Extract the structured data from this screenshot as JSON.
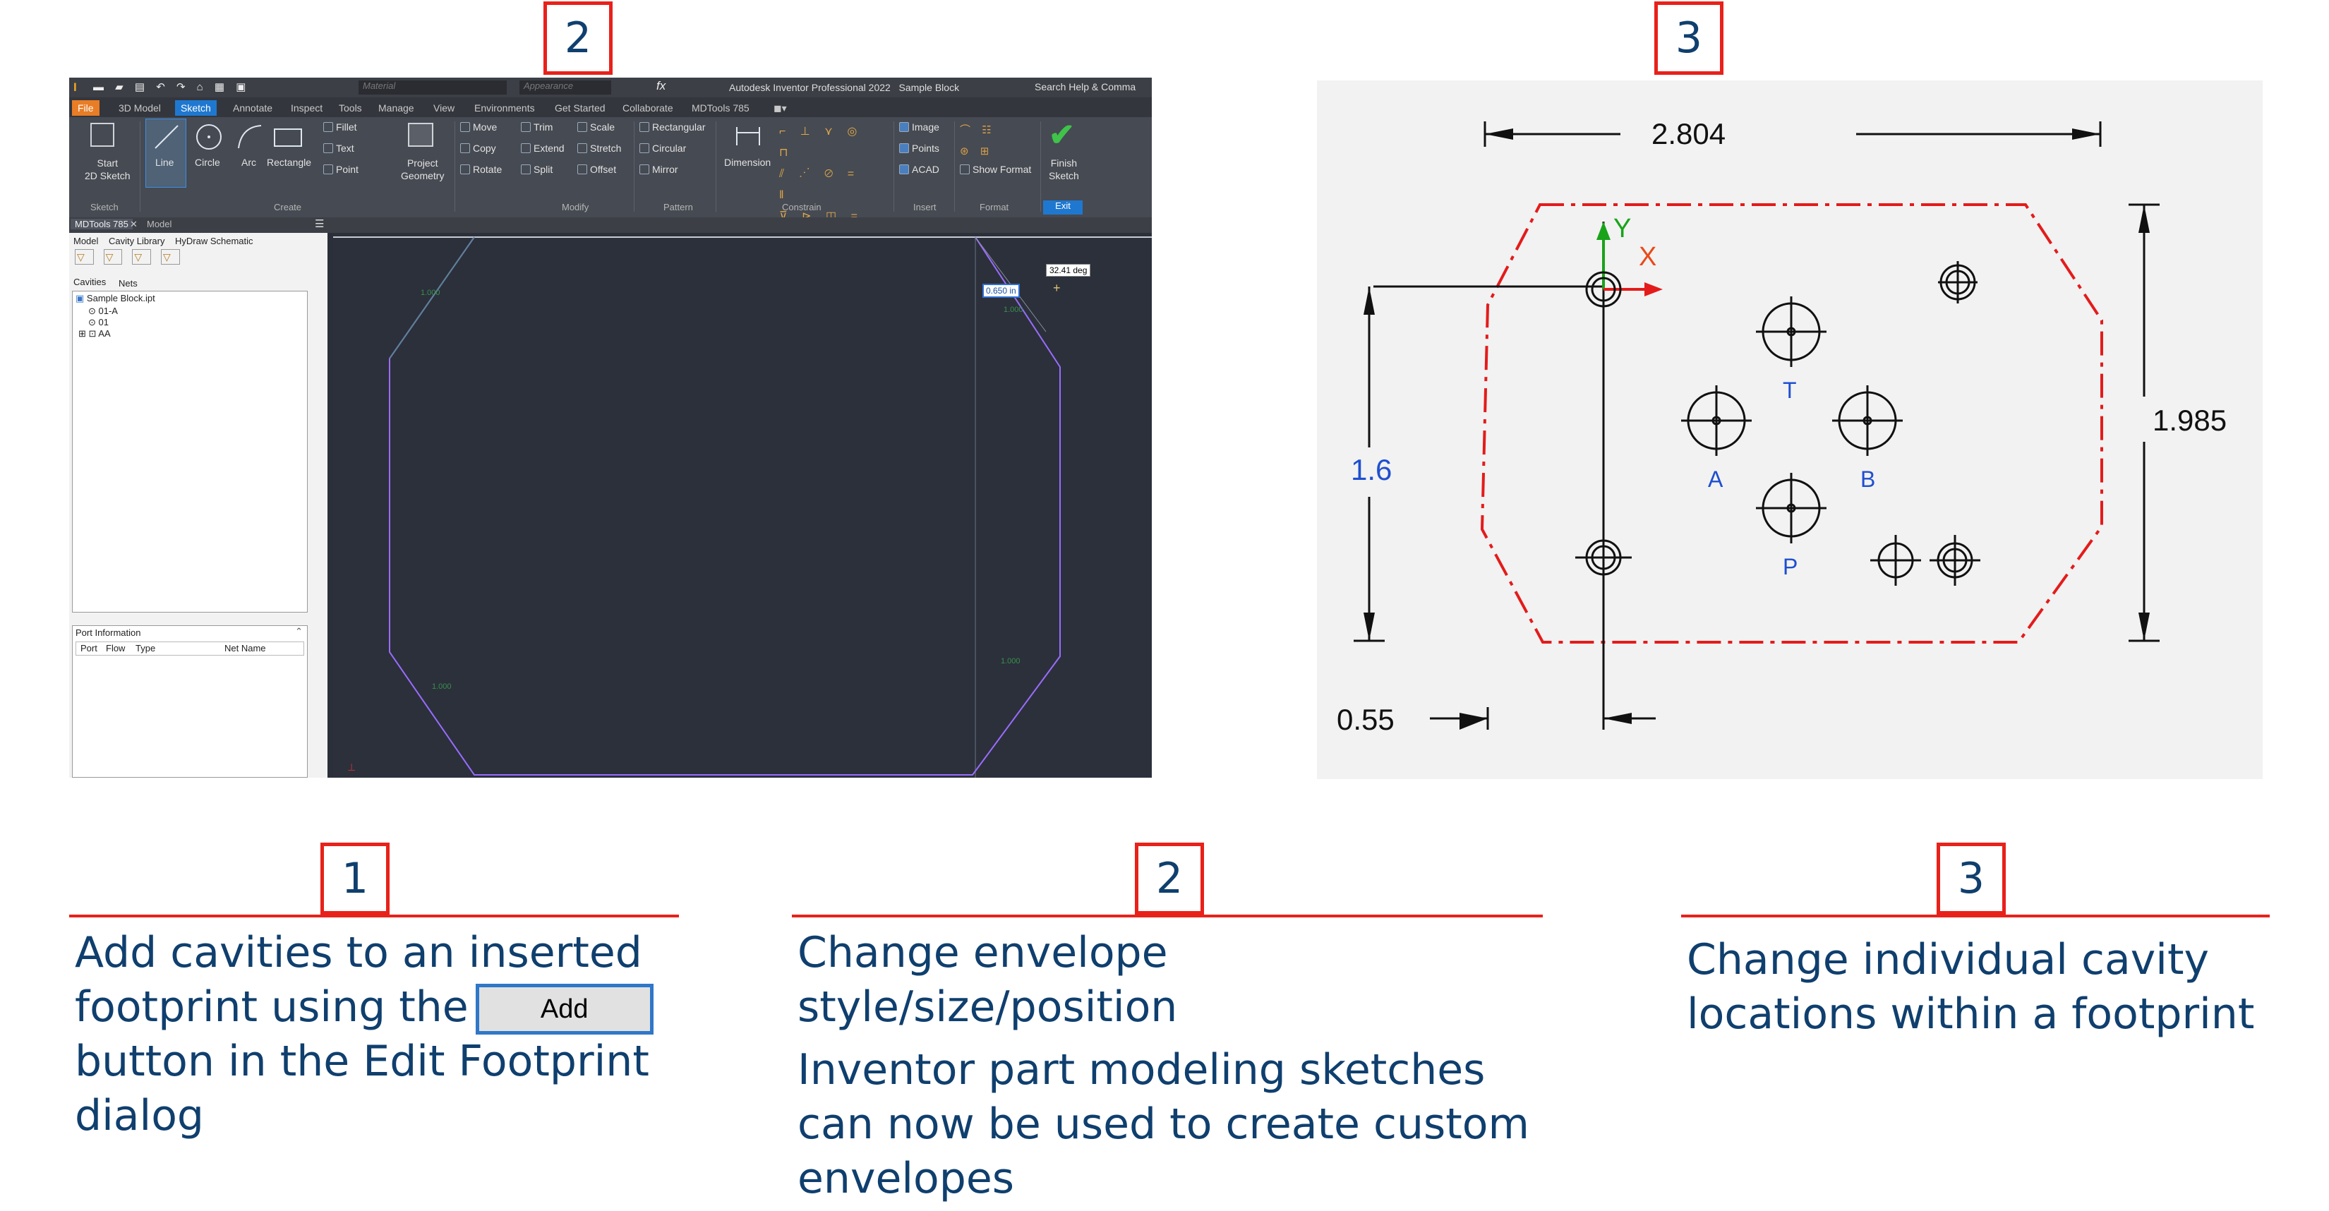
{
  "steps": [
    {
      "num": "1",
      "caption_before": "Add cavities to an inserted footprint using the",
      "button": "Add",
      "caption_after": "button in the Edit Footprint dialog"
    },
    {
      "num": "2",
      "caption_line1": "Change envelope style/size/position",
      "caption_line2": "Inventor part modeling sketches can now be used to create custom envelopes"
    },
    {
      "num": "3",
      "caption": "Change individual cavity locations within a footprint"
    }
  ],
  "top_labels": {
    "left": "2",
    "right": "3"
  },
  "colors": {
    "accent_red": "#e8211a",
    "text_blue": "#0f3f6e",
    "sketch_line": "#9a6cff",
    "envelope_red": "#e41b1b"
  },
  "inventor": {
    "window_title": "Autodesk Inventor Professional 2022   Sample Block",
    "search": "Search Help & Comma",
    "material": "Material",
    "appearance": "Appearance",
    "tabs": [
      "File",
      "3D Model",
      "Sketch",
      "Annotate",
      "Inspect",
      "Tools",
      "Manage",
      "View",
      "Environments",
      "Get Started",
      "Collaborate",
      "MDTools 785"
    ],
    "ribbon": {
      "start_sketch": "Start\n2D Sketch",
      "line": "Line",
      "circle": "Circle",
      "arc": "Arc",
      "rectangle": "Rectangle",
      "fillet": "Fillet",
      "text": "Text",
      "point": "Point",
      "project_geometry": "Project\nGeometry",
      "move": "Move",
      "copy": "Copy",
      "rotate": "Rotate",
      "trim": "Trim",
      "extend": "Extend",
      "split": "Split",
      "scale": "Scale",
      "stretch": "Stretch",
      "offset": "Offset",
      "rectangular": "Rectangular",
      "circular": "Circular",
      "mirror": "Mirror",
      "dimension": "Dimension",
      "image": "Image",
      "points": "Points",
      "acad": "ACAD",
      "show_format": "Show Format",
      "finish_sketch": "Finish\nSketch",
      "groups": [
        "Sketch",
        "Create",
        "Modify",
        "Pattern",
        "Constrain",
        "Insert",
        "Format",
        "Exit"
      ]
    },
    "doc_tabs": [
      "MDTools 785",
      "Model"
    ],
    "panel_tabs": [
      "Model",
      "Cavity Library",
      "HyDraw Schematic"
    ],
    "subtabs": [
      "Cavities",
      "Nets"
    ],
    "tree": [
      "Sample Block.ipt",
      "01-A",
      "01",
      "AA"
    ],
    "port_info": "Port Information",
    "port_cols": [
      "Port",
      "Flow",
      "Type",
      "Net Name"
    ],
    "angle_tip": "32.41 deg",
    "dim_input": "0.650 in",
    "dim_labels": [
      "1.000",
      "1.000",
      "1.000",
      "1.000"
    ]
  },
  "drawing": {
    "dim_width": "2.804",
    "dim_height": "1.985",
    "dim_y": "1.6",
    "dim_x": "0.55",
    "axis_x": "X",
    "axis_y": "Y",
    "cavity_labels": [
      "T",
      "A",
      "B",
      "P"
    ]
  }
}
